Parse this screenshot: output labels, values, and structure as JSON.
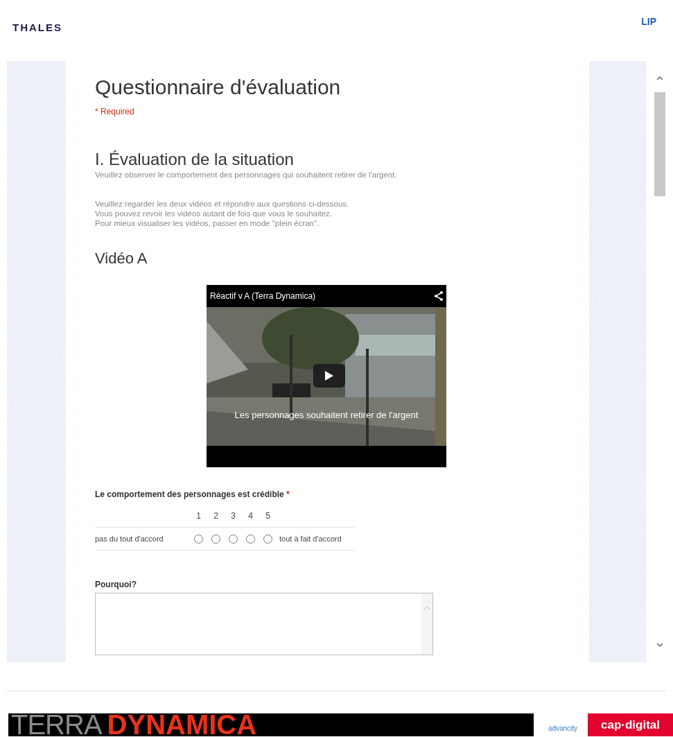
{
  "header": {
    "left_logo": "THALES",
    "right_logo": "LIP"
  },
  "form": {
    "title": "Questionnaire d'évaluation",
    "required_note": "* Required",
    "section": {
      "title": "I. Évaluation de la situation",
      "subtitle": "Veuillez observer le comportement des personnages qui souhaitent retirer de l'argent.",
      "instructions": [
        "Veuillez regarder les deux vidéos et répondre aux questions ci-dessous.",
        "Vous pouvez revoir les vidéos autant de fois que vous le souhaitez.",
        "Pour mieux visualiser les vidéos, passer en mode \"plein écran\"."
      ]
    },
    "video_heading": "Vidéo A",
    "video": {
      "title": "Réactif v A (Terra Dynamica)",
      "caption": "Les personnages souhaitent retirer de l'argent"
    },
    "question": {
      "label": "Le comportement des personnages est crédible",
      "required_mark": "*",
      "low_label": "pas du tout d'accord",
      "high_label": "tout à fait d'accord",
      "options": [
        {
          "label": "1",
          "selected": false
        },
        {
          "label": "2",
          "selected": false
        },
        {
          "label": "3",
          "selected": false
        },
        {
          "label": "4",
          "selected": false
        },
        {
          "label": "5",
          "selected": false
        }
      ]
    },
    "why_label": "Pourquoi?"
  },
  "footer": {
    "banner_left": "TERRA",
    "banner_right": "DYNAMICA",
    "partner_logo": "advancity",
    "partner_logo_2": "cap·digital"
  }
}
